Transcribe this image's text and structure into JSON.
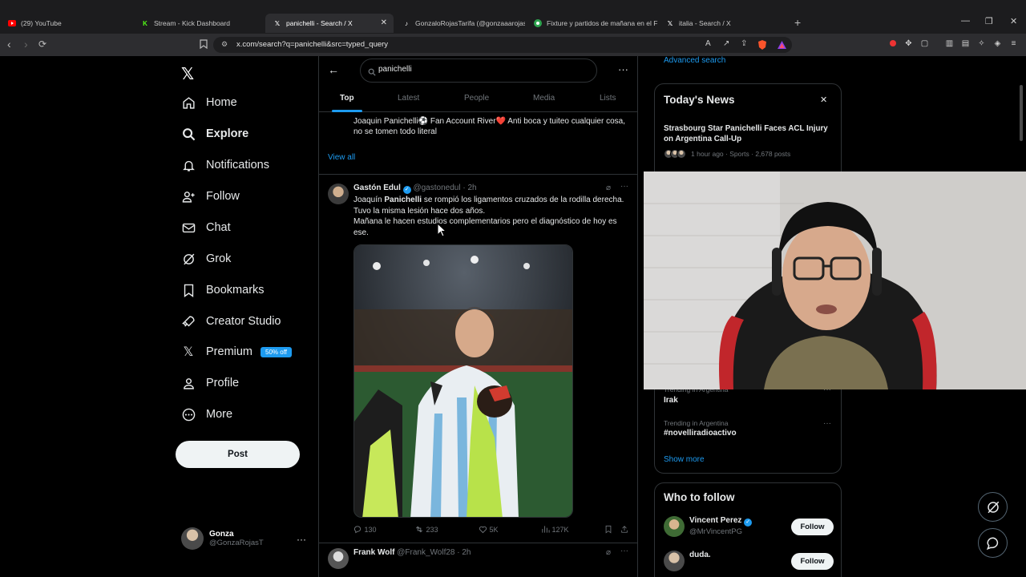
{
  "browser": {
    "tabs": [
      {
        "title": "(29) YouTube",
        "icon": "youtube-icon",
        "color": "#ff0000"
      },
      {
        "title": "Stream - Kick Dashboard",
        "icon": "kick-icon",
        "color": "#53fc18"
      },
      {
        "title": "panichelli - Search / X",
        "icon": "x-icon",
        "color": "#ffffff",
        "active": true
      },
      {
        "title": "GonzaloRojasTarifa (@gonzaaarojas)",
        "icon": "tiktok-icon",
        "color": "#ffffff"
      },
      {
        "title": "Fixture y partidos de mañana en el F",
        "icon": "site-icon",
        "color": "#2ea44f"
      },
      {
        "title": "italia - Search / X",
        "icon": "x-icon",
        "color": "#ffffff"
      }
    ],
    "url": "x.com/search?q=panichelli&src=typed_query"
  },
  "sidebar": {
    "items": [
      {
        "label": "Home",
        "icon": "home-icon"
      },
      {
        "label": "Explore",
        "icon": "search-icon",
        "bold": true
      },
      {
        "label": "Notifications",
        "icon": "bell-icon"
      },
      {
        "label": "Follow",
        "icon": "follow-icon"
      },
      {
        "label": "Chat",
        "icon": "mail-icon"
      },
      {
        "label": "Grok",
        "icon": "grok-icon"
      },
      {
        "label": "Bookmarks",
        "icon": "bookmark-icon"
      },
      {
        "label": "Creator Studio",
        "icon": "rocket-icon"
      },
      {
        "label": "Premium",
        "icon": "x-icon",
        "badge": "50% off"
      },
      {
        "label": "Profile",
        "icon": "person-icon"
      },
      {
        "label": "More",
        "icon": "more-circle-icon"
      }
    ],
    "post_label": "Post",
    "account": {
      "name": "Gonza",
      "handle": "@GonzaRojasT"
    }
  },
  "search": {
    "query": "panichelli",
    "tabs": [
      "Top",
      "Latest",
      "People",
      "Media",
      "Lists"
    ],
    "active_tab": "Top"
  },
  "people_result": {
    "bio": "Joaquin Panichelli⚽ Fan Account River❤️ Anti boca y tuiteo cualquier cosa, no se tomen todo literal",
    "view_all": "View all"
  },
  "tweets": [
    {
      "name": "Gastón Edul",
      "handle": "@gastonedul",
      "time": "· 2h",
      "text_pre": "Joaquín ",
      "text_bold": "Panichelli",
      "text_post": " se rompió los ligamentos cruzados de la rodilla derecha.",
      "text_line2": "Tuvo la misma lesión hace dos años.",
      "text_line3": "Mañana le hacen estudios complementarios pero el diagnóstico de hoy es ese.",
      "stats": {
        "replies": "130",
        "reposts": "233",
        "likes": "5K",
        "views": "127K"
      }
    },
    {
      "name": "Frank Wolf",
      "handle": "@Frank_Wolf28",
      "time": "· 2h"
    }
  ],
  "right": {
    "advanced_search": "Advanced search",
    "news": {
      "title": "Today's News",
      "headline": "Strasbourg Star Panichelli Faces ACL Injury on Argentina Call-Up",
      "meta": "1 hour ago · Sports · 2,678 posts"
    },
    "trends": [
      {
        "context": "Trending in Argentina",
        "name": "Irak"
      },
      {
        "context": "Trending in Argentina",
        "name": "#novelliradioactivo"
      }
    ],
    "show_more": "Show more",
    "who_to_follow": {
      "title": "Who to follow",
      "users": [
        {
          "name": "Vincent Perez",
          "handle": "@MrVincentPG",
          "verified": true,
          "button": "Follow"
        },
        {
          "name": "duda.",
          "handle": "",
          "button": "Follow"
        }
      ]
    }
  },
  "colors": {
    "accent": "#1d9bf0",
    "background": "#000000",
    "border": "#2f3336",
    "muted": "#71767b"
  }
}
